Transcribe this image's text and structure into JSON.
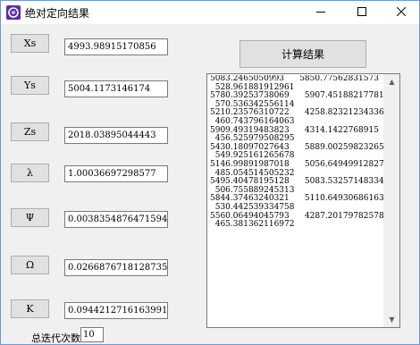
{
  "window": {
    "title": "绝对定向结果"
  },
  "params": [
    {
      "label": "Xs",
      "value": "4993.98915170856"
    },
    {
      "label": "Ys",
      "value": "5004.1173146174"
    },
    {
      "label": "Zs",
      "value": "2018.03895044443"
    },
    {
      "label": "λ",
      "value": "1.00036697298577"
    },
    {
      "label": "Ψ",
      "value": "0.00383548764715941"
    },
    {
      "label": "Ω",
      "value": "0.0266876718128735"
    },
    {
      "label": "K",
      "value": "0.0944212716163991"
    }
  ],
  "calc_button": "计算结果",
  "results_text": "5083.2465050993      5850.77562831573\n  528.961881912961\n5780.39253738069      5907.45188217781\n  570.536342556114\n5210.23576310722      4258.82321234336\n  460.743796164063\n5909.49319483823      4314.1422768915\n  456.525979508295\n5430.18097027643      5889.00259823265\n  549.925161265678\n5146.99891987018      5056.64949912827\n  485.054514505232\n5495.40478195128      5083.53257148334\n  506.755889245313\n5844.37463240321      5110.64930686163\n  530.442539334758\n5560.06494045793      4287.20179782578\n  465.381362116972",
  "iterations": {
    "label": "总迭代次数",
    "value": "10"
  }
}
